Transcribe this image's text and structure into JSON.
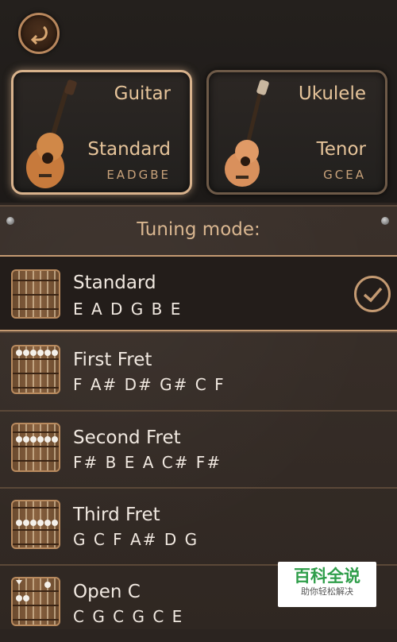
{
  "header": {
    "back_icon": "back-arrow-icon"
  },
  "instruments": [
    {
      "name": "Guitar",
      "tuning": "Standard",
      "notes": "EADGBE",
      "selected": true
    },
    {
      "name": "Ukulele",
      "tuning": "Tenor",
      "notes": "GCEA",
      "selected": false
    }
  ],
  "tuning": {
    "title": "Tuning mode:",
    "modes": [
      {
        "name": "Standard",
        "notes": "E A D G B E",
        "selected": true
      },
      {
        "name": "First Fret",
        "notes": "F A# D# G# C F",
        "selected": false
      },
      {
        "name": "Second Fret",
        "notes": "F# B E A C# F#",
        "selected": false
      },
      {
        "name": "Third Fret",
        "notes": "G C F A# D G",
        "selected": false
      },
      {
        "name": "Open C",
        "notes": "C G C G C E",
        "selected": false
      }
    ]
  },
  "watermark": {
    "title": "百科全说",
    "subtitle": "助你轻松解决"
  },
  "colors": {
    "accent": "#c49a72",
    "text_gold": "#e6c49a",
    "row_text": "#f0e8e0"
  }
}
